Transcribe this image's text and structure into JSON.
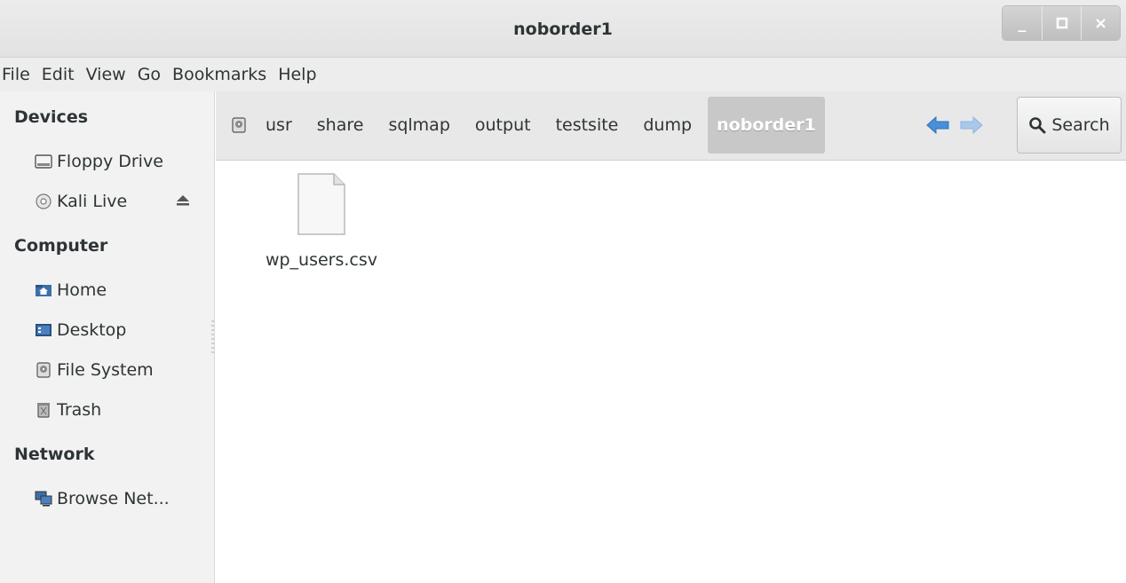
{
  "window": {
    "title": "noborder1",
    "buttons": {
      "minimize": "_",
      "maximize": "□",
      "close": "×"
    }
  },
  "menu": [
    "File",
    "Edit",
    "View",
    "Go",
    "Bookmarks",
    "Help"
  ],
  "sidebar": {
    "devices_header": "Devices",
    "devices": [
      {
        "label": "Floppy Drive",
        "icon": "floppy-drive-icon"
      },
      {
        "label": "Kali Live",
        "icon": "disc-icon"
      }
    ],
    "computer_header": "Computer",
    "computer": [
      {
        "label": "Home",
        "icon": "home-folder-icon"
      },
      {
        "label": "Desktop",
        "icon": "desktop-icon"
      },
      {
        "label": "File System",
        "icon": "drive-icon"
      },
      {
        "label": "Trash",
        "icon": "trash-icon"
      }
    ],
    "network_header": "Network",
    "network": [
      {
        "label": "Browse Net...",
        "icon": "network-icon"
      }
    ]
  },
  "pathbar": {
    "crumbs": [
      "usr",
      "share",
      "sqlmap",
      "output",
      "testsite",
      "dump"
    ],
    "current": "noborder1",
    "search_label": "Search"
  },
  "files": [
    {
      "name": "wp_users.csv",
      "icon": "text-file-icon"
    }
  ],
  "colors": {
    "accent_arrow": "#4a90d9",
    "accent_arrow_disabled": "#a9c8ea",
    "active_crumb_bg": "#c8c8c8"
  }
}
